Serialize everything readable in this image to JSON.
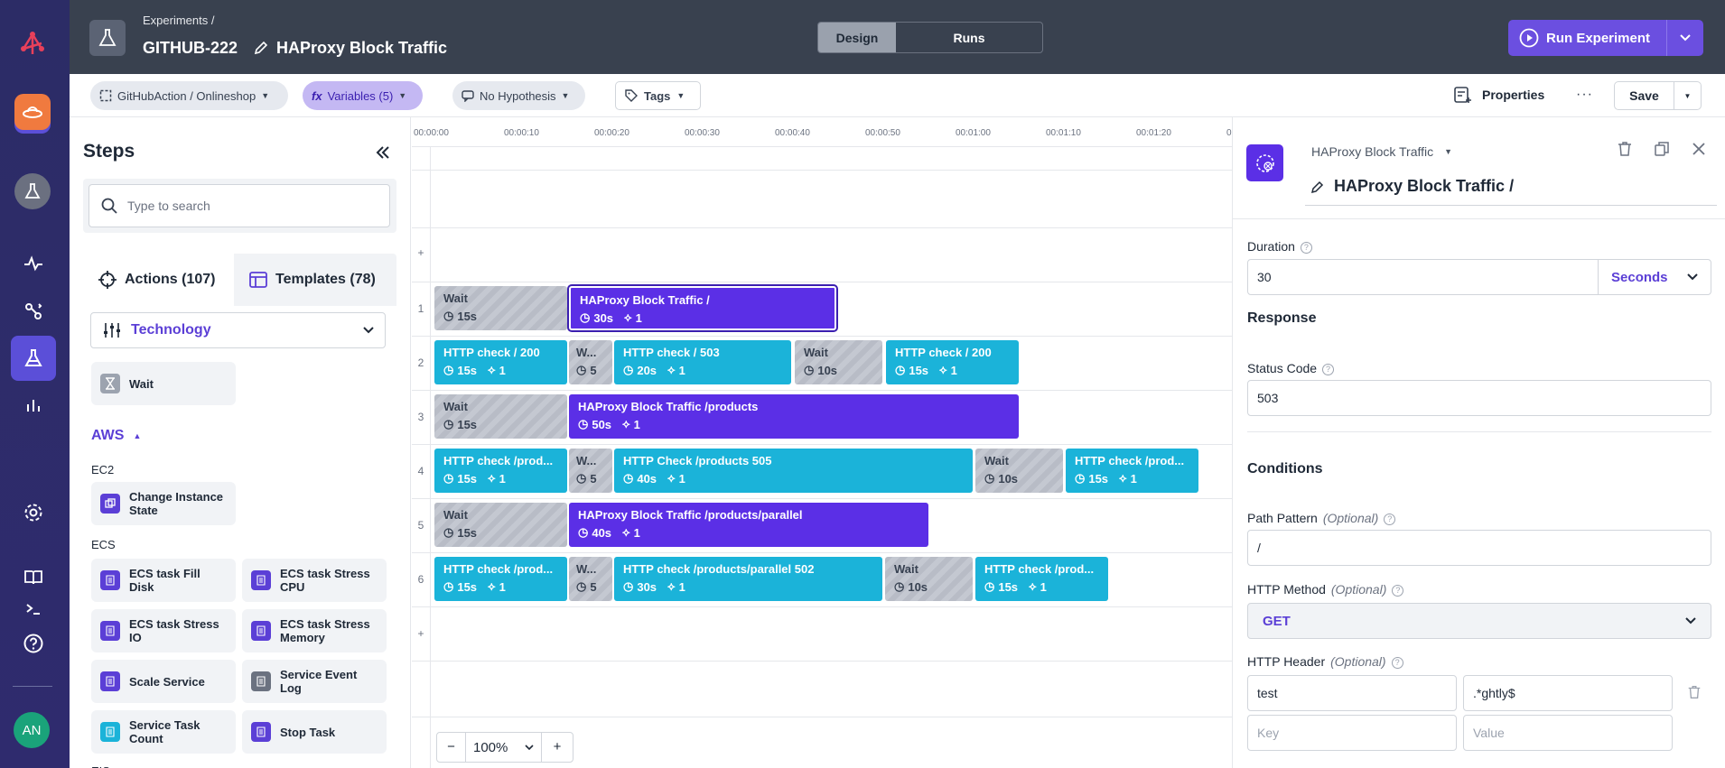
{
  "header": {
    "breadcrumb": "Experiments /",
    "experiment_key": "GITHUB-222",
    "experiment_name": "HAProxy Block Traffic",
    "tabs": [
      "Design",
      "Runs"
    ],
    "active_tab": "Design",
    "run_button": "Run Experiment"
  },
  "subbar": {
    "environment": "GitHubAction / Onlineshop",
    "variables": "Variables (5)",
    "hypothesis": "No Hypothesis",
    "tags": "Tags",
    "properties": "Properties",
    "save": "Save"
  },
  "rail": {
    "avatar_initials": "AN",
    "icons": [
      "logo-icon",
      "ufo-icon",
      "flask-icon",
      "pulse-icon",
      "route-icon",
      "experiments-icon",
      "bar-chart-icon",
      "gear-icon",
      "book-icon",
      "terminal-icon",
      "help-icon"
    ]
  },
  "steps": {
    "title": "Steps",
    "search_placeholder": "Type to search",
    "tab_actions": "Actions (107)",
    "tab_templates": "Templates (78)",
    "filter": "Technology",
    "wait": "Wait",
    "aws_label": "AWS",
    "ec2_label": "EC2",
    "change_instance": "Change Instance State",
    "ecs_label": "ECS",
    "cards": [
      "ECS task Fill Disk",
      "ECS task Stress CPU",
      "ECS task Stress IO",
      "ECS task Stress Memory",
      "Scale Service",
      "Service Event Log",
      "Service Task Count",
      "Stop Task"
    ],
    "more_label": "EIS"
  },
  "timeline": {
    "ticks": [
      "00:00:00",
      "00:00:10",
      "00:00:20",
      "00:00:30",
      "00:00:40",
      "00:00:50",
      "00:01:00",
      "00:01:10",
      "00:01:20",
      "0"
    ],
    "lanes": [
      "1",
      "2",
      "3",
      "4",
      "5",
      "6"
    ],
    "add": "+",
    "zoom": "100%",
    "zoom_minus": "−",
    "zoom_plus": "+",
    "blocks": [
      {
        "type": "wait",
        "name": "Wait",
        "duration": "15s",
        "count": ""
      },
      {
        "type": "ha",
        "name": "HAProxy Block Traffic /",
        "duration": "30s",
        "count": "1"
      },
      {
        "type": "http",
        "name": "HTTP check / 200",
        "duration": "15s",
        "count": "1"
      },
      {
        "type": "wait",
        "name": "W...",
        "duration": "5",
        "count": ""
      },
      {
        "type": "http",
        "name": "HTTP check / 503",
        "duration": "20s",
        "count": "1"
      },
      {
        "type": "wait",
        "name": "Wait",
        "duration": "10s",
        "count": ""
      },
      {
        "type": "http",
        "name": "HTTP check / 200",
        "duration": "15s",
        "count": "1"
      },
      {
        "type": "wait",
        "name": "Wait",
        "duration": "15s",
        "count": ""
      },
      {
        "type": "ha",
        "name": "HAProxy Block Traffic /products",
        "duration": "50s",
        "count": "1"
      },
      {
        "type": "http",
        "name": "HTTP check /prod...",
        "duration": "15s",
        "count": "1"
      },
      {
        "type": "wait",
        "name": "W...",
        "duration": "5",
        "count": ""
      },
      {
        "type": "http",
        "name": "HTTP Check /products 505",
        "duration": "40s",
        "count": "1"
      },
      {
        "type": "wait",
        "name": "Wait",
        "duration": "10s",
        "count": ""
      },
      {
        "type": "http",
        "name": "HTTP check /prod...",
        "duration": "15s",
        "count": "1"
      },
      {
        "type": "wait",
        "name": "Wait",
        "duration": "15s",
        "count": ""
      },
      {
        "type": "ha",
        "name": "HAProxy Block Traffic /products/parallel",
        "duration": "40s",
        "count": "1"
      },
      {
        "type": "http",
        "name": "HTTP check /prod...",
        "duration": "15s",
        "count": "1"
      },
      {
        "type": "wait",
        "name": "W...",
        "duration": "5",
        "count": ""
      },
      {
        "type": "http",
        "name": "HTTP check /products/parallel 502",
        "duration": "30s",
        "count": "1"
      },
      {
        "type": "wait",
        "name": "Wait",
        "duration": "10s",
        "count": ""
      },
      {
        "type": "http",
        "name": "HTTP check /prod...",
        "duration": "15s",
        "count": "1"
      }
    ]
  },
  "panel": {
    "action_type": "HAProxy Block Traffic",
    "step_name": "HAProxy Block Traffic /",
    "duration_label": "Duration",
    "duration_value": "30",
    "duration_unit": "Seconds",
    "response_label": "Response",
    "status_code_label": "Status Code",
    "status_code_value": "503",
    "conditions_label": "Conditions",
    "path_label": "Path Pattern",
    "optional": "(Optional)",
    "path_value": "/",
    "method_label": "HTTP Method",
    "method_value": "GET",
    "header_label": "HTTP Header",
    "header_key_value": "test",
    "header_val_value": ".*ghtly$",
    "key_placeholder": "Key",
    "value_placeholder": "Value"
  },
  "colors": {
    "rail": "#2c2c66",
    "header": "#39414f",
    "accent": "#5b2fe6",
    "http": "#1bb3d9"
  }
}
